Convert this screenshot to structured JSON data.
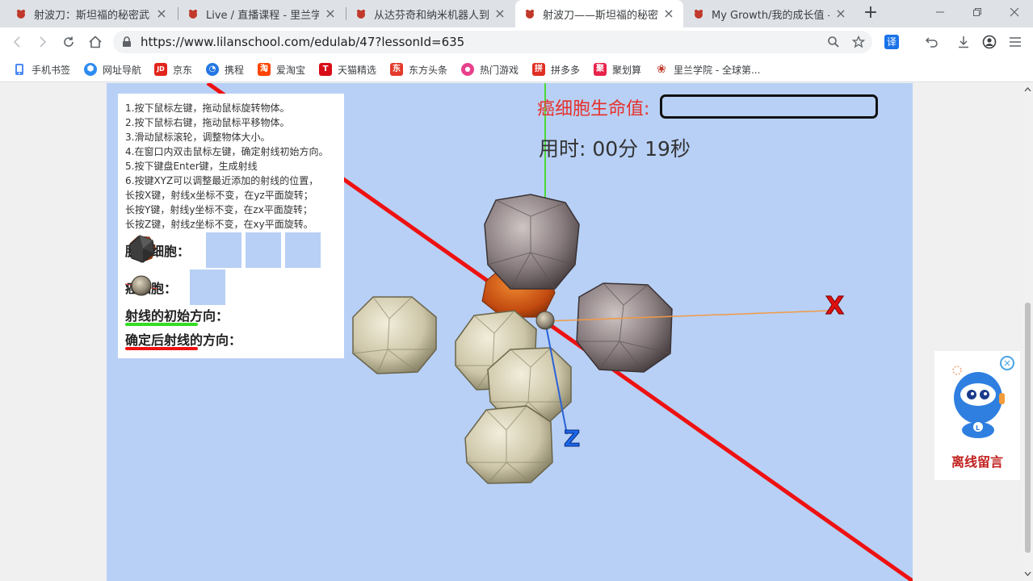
{
  "tabs": [
    {
      "title": "射波刀：斯坦福的秘密武器",
      "active": false
    },
    {
      "title": "Live / 直播课程 - 里兰学院",
      "active": false
    },
    {
      "title": "从达芬奇和纳米机器人到大",
      "active": false
    },
    {
      "title": "射波刀——斯坦福的秘密武",
      "active": true
    },
    {
      "title": "My Growth/我的成长值 - /",
      "active": false
    }
  ],
  "address": {
    "url": "https://www.lilanschool.com/edulab/47?lessonId=635"
  },
  "toolbar": {
    "translate_label": "译"
  },
  "bookmarks": [
    {
      "label": "手机书签",
      "icon": "mobile-bookmark-icon",
      "color": "#4a8af4",
      "glyph": ""
    },
    {
      "label": "网址导航",
      "icon": "nav-icon",
      "color": "#2d8cf0",
      "glyph": "⬢"
    },
    {
      "label": "京东",
      "icon": "jd-icon",
      "color": "#e1251b",
      "glyph": "JD"
    },
    {
      "label": "携程",
      "icon": "ctrip-icon",
      "color": "#2577e3",
      "glyph": "◔"
    },
    {
      "label": "爱淘宝",
      "icon": "taobao-icon",
      "color": "#ff4400",
      "glyph": "淘"
    },
    {
      "label": "天猫精选",
      "icon": "tmall-icon",
      "color": "#d80c18",
      "glyph": "T"
    },
    {
      "label": "东方头条",
      "icon": "toutiao-icon",
      "color": "#e33a2c",
      "glyph": "东"
    },
    {
      "label": "热门游戏",
      "icon": "game-icon",
      "color": "#e8408c",
      "glyph": "●"
    },
    {
      "label": "拼多多",
      "icon": "pinduoduo-icon",
      "color": "#e02e24",
      "glyph": "拼"
    },
    {
      "label": "聚划算",
      "icon": "juhuasuan-icon",
      "color": "#e8234b",
      "glyph": "聚"
    },
    {
      "label": "里兰学院 - 全球第...",
      "icon": "lilan-icon",
      "color": "#c0392b",
      "glyph": "❀"
    }
  ],
  "panel": {
    "instructions": [
      "1.按下鼠标左键，拖动鼠标旋转物体。",
      "2.按下鼠标右键，拖动鼠标平移物体。",
      "3.滑动鼠标滚轮，调整物体大小。",
      "4.在窗口内双击鼠标左键，确定射线初始方向。",
      "5.按下键盘Enter键，生成射线",
      "6.按键XYZ可以调整最近添加的射线的位置，",
      "长按X键，射线x坐标不变，在yz平面旋转；",
      "长按Y键，射线y坐标不变，在zx平面旋转；",
      "长按Z键，射线z坐标不变，在xy平面旋转。"
    ],
    "fragile_label": "脆弱细胞：",
    "cancer_label": "癌细胞：",
    "initial_dir_label": "射线的初始方向：",
    "confirmed_dir_label": "确定后射线的方向：",
    "initial_dir_color": "#33dd22",
    "confirmed_dir_color": "#ee1111"
  },
  "hud": {
    "hp_label": "癌细胞生命值:",
    "hp_value": 0,
    "timer": "用时: 00分 19秒"
  },
  "axes": {
    "x_label": "X",
    "z_label": "Z"
  },
  "widget": {
    "label": "离线留言"
  }
}
